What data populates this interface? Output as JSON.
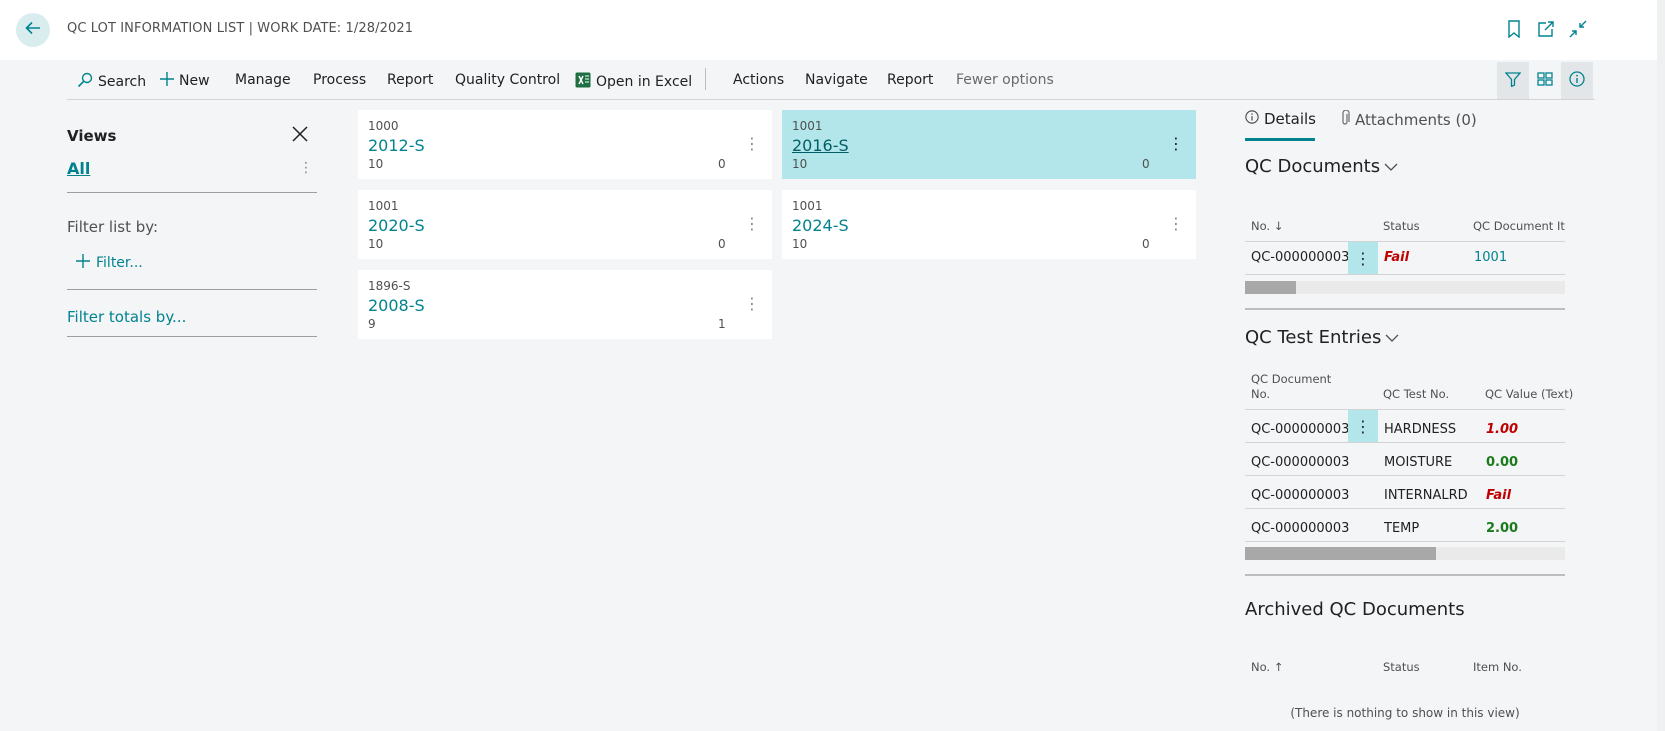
{
  "header": {
    "title": "QC LOT INFORMATION LIST | WORK DATE: 1/28/2021",
    "icons": [
      "back-arrow-icon",
      "bookmark-icon",
      "open-new-window-icon",
      "collapse-icon"
    ]
  },
  "toolbar": {
    "search": "Search",
    "new": "New",
    "manage": "Manage",
    "process": "Process",
    "report": "Report",
    "quality_control": "Quality Control",
    "open_in_excel": "Open in Excel",
    "actions": "Actions",
    "navigate": "Navigate",
    "report2": "Report",
    "fewer_options": "Fewer options",
    "right_icons": [
      "filter-icon",
      "layout-icon",
      "info-icon"
    ]
  },
  "views": {
    "title": "Views",
    "all": "All",
    "filter_list_by": "Filter list by:",
    "filter_add": "Filter...",
    "filter_totals": "Filter totals by..."
  },
  "cards": [
    {
      "item_no": "1000",
      "lot_no": "2012-S",
      "qty": "10",
      "qty2": "0",
      "selected": false
    },
    {
      "item_no": "1001",
      "lot_no": "2016-S",
      "qty": "10",
      "qty2": "0",
      "selected": true
    },
    {
      "item_no": "1001",
      "lot_no": "2020-S",
      "qty": "10",
      "qty2": "0",
      "selected": false
    },
    {
      "item_no": "1001",
      "lot_no": "2024-S",
      "qty": "10",
      "qty2": "0",
      "selected": false
    },
    {
      "item_no": "1896-S",
      "lot_no": "2008-S",
      "qty": "9",
      "qty2": "1",
      "selected": false
    }
  ],
  "factbox": {
    "tab_details": "Details",
    "tab_attachments": "Attachments (0)",
    "qc_documents": {
      "title": "QC Documents",
      "col_no": "No. ↓",
      "col_status": "Status",
      "col_item": "QC Document Ite",
      "rows": [
        {
          "no": "QC-000000003",
          "status": "Fail",
          "item": "1001"
        }
      ]
    },
    "qc_test_entries": {
      "title": "QC Test Entries",
      "col_doc_line1": "QC Document",
      "col_doc_line2": "No.",
      "col_test": "QC Test No.",
      "col_value": "QC Value (Text)",
      "rows": [
        {
          "doc": "QC-000000003",
          "test": "HARDNESS",
          "value": "1.00",
          "kind": "fail"
        },
        {
          "doc": "QC-000000003",
          "test": "MOISTURE",
          "value": "0.00",
          "kind": "ok"
        },
        {
          "doc": "QC-000000003",
          "test": "INTERNALRD",
          "value": "Fail",
          "kind": "fail"
        },
        {
          "doc": "QC-000000003",
          "test": "TEMP",
          "value": "2.00",
          "kind": "ok"
        }
      ]
    },
    "archived": {
      "title": "Archived QC Documents",
      "col_no": "No. ↑",
      "col_status": "Status",
      "col_item": "Item No.",
      "empty": "(There is nothing to show in this view)"
    }
  },
  "colors": {
    "accent": "#00838f",
    "selected_bg": "#b2e6ea",
    "fail": "#c00000",
    "ok": "#1b7a1b"
  }
}
